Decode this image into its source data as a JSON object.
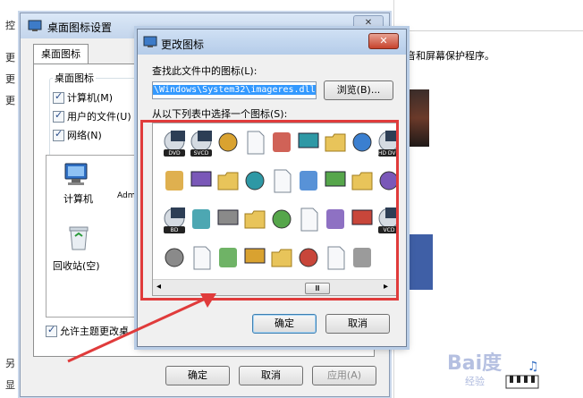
{
  "background": {
    "left_fragments": [
      "控",
      "更",
      "更",
      "更",
      "另",
      "显"
    ],
    "right_description": "音和屏幕保护程序。"
  },
  "desktop_icon_settings": {
    "title": "桌面图标设置",
    "close_glyph": "✕",
    "tab_label": "桌面图标",
    "group_label": "桌面图标",
    "checkboxes": [
      {
        "label": "计算机(M)",
        "checked": true
      },
      {
        "label": "用户的文件(U)",
        "checked": true
      },
      {
        "label": "网络(N)",
        "checked": true
      }
    ],
    "desktop_icons": [
      {
        "label": "计算机"
      },
      {
        "label": "Adm"
      },
      {
        "label": "回收站(空)"
      }
    ],
    "allow_themes_label": "允许主题更改桌",
    "ok_label": "确定",
    "cancel_label": "取消",
    "apply_label": "应用(A)"
  },
  "change_icon": {
    "title": "更改图标",
    "close_glyph": "✕",
    "find_label": "查找此文件中的图标(L):",
    "path_value": "\\Windows\\System32\\imageres.dll",
    "browse_label": "浏览(B)...",
    "select_label": "从以下列表中选择一个图标(S):",
    "scroll_left": "◂",
    "scroll_right": "▸",
    "scroll_thumb": "Ⅲ",
    "ok_label": "确定",
    "cancel_label": "取消",
    "icons": [
      {
        "name": "dvd-video-icon",
        "tag": "DVD"
      },
      {
        "name": "svcd-icon",
        "tag": "SVCD"
      },
      {
        "name": "help-disc-icon",
        "tag": ""
      },
      {
        "name": "monitor-chart-icon",
        "tag": ""
      },
      {
        "name": "green-check-icon",
        "tag": ""
      },
      {
        "name": "settings-box-icon",
        "tag": ""
      },
      {
        "name": "checklist-icon",
        "tag": ""
      },
      {
        "name": "download-icon",
        "tag": ""
      },
      {
        "name": "hd-dvd-icon",
        "tag": "HD DVD"
      },
      {
        "name": "user-arrow-icon",
        "tag": ""
      },
      {
        "name": "network-sync-icon",
        "tag": ""
      },
      {
        "name": "network-computers-icon",
        "tag": ""
      },
      {
        "name": "desktop-pc-icon",
        "tag": ""
      },
      {
        "name": "font-file-icon",
        "tag": ""
      },
      {
        "name": "folder-doc-icon",
        "tag": ""
      },
      {
        "name": "folder-icon",
        "tag": ""
      },
      {
        "name": "folder-check-icon",
        "tag": ""
      },
      {
        "name": "red-x-icon",
        "tag": ""
      },
      {
        "name": "bd-disc-icon",
        "tag": "BD"
      },
      {
        "name": "globe-clock-icon",
        "tag": ""
      },
      {
        "name": "documents-icon",
        "tag": ""
      },
      {
        "name": "network-printer-icon",
        "tag": ""
      },
      {
        "name": "font-tc-icon",
        "tag": ""
      },
      {
        "name": "shortcut-arrow-icon",
        "tag": ""
      },
      {
        "name": "disconnect-icon",
        "tag": ""
      },
      {
        "name": "folder-orange-icon",
        "tag": ""
      },
      {
        "name": "vcd-icon",
        "tag": "VCD"
      },
      {
        "name": "media-disc-icon",
        "tag": ""
      },
      {
        "name": "monitor-search-icon",
        "tag": ""
      },
      {
        "name": "desktop-screen-icon",
        "tag": ""
      },
      {
        "name": "red-disc-icon",
        "tag": ""
      },
      {
        "name": "opentype-font-icon",
        "tag": ""
      },
      {
        "name": "users-small-icon",
        "tag": ""
      },
      {
        "name": "photo-tray-icon",
        "tag": ""
      },
      {
        "name": "disc-drive-icon",
        "tag": ""
      }
    ]
  },
  "annotation": {
    "color": "#e03b3b"
  },
  "watermark": {
    "text": "Bai度",
    "sub": "经验"
  }
}
